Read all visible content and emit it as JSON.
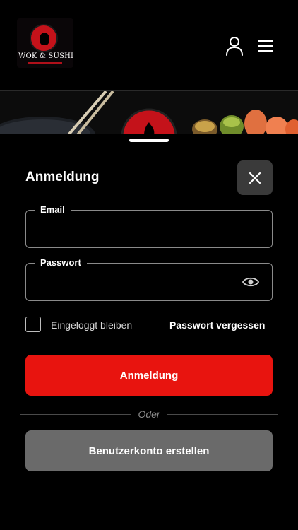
{
  "brand": {
    "name": "WOK & SUSHI",
    "accent_color": "#e8140f"
  },
  "header": {
    "user_icon": "user-icon",
    "menu_icon": "hamburger-menu-icon"
  },
  "login": {
    "title": "Anmeldung",
    "close_icon": "close-icon",
    "email": {
      "label": "Email",
      "value": "",
      "placeholder": ""
    },
    "password": {
      "label": "Passwort",
      "value": "",
      "placeholder": "",
      "toggle_icon": "eye-icon"
    },
    "remember_label": "Eingeloggt bleiben",
    "remember_checked": false,
    "forgot_label": "Passwort vergessen",
    "submit_label": "Anmeldung",
    "or_label": "Oder",
    "register_label": "Benutzerkonto erstellen",
    "secondary_color": "#6a6a6a"
  }
}
